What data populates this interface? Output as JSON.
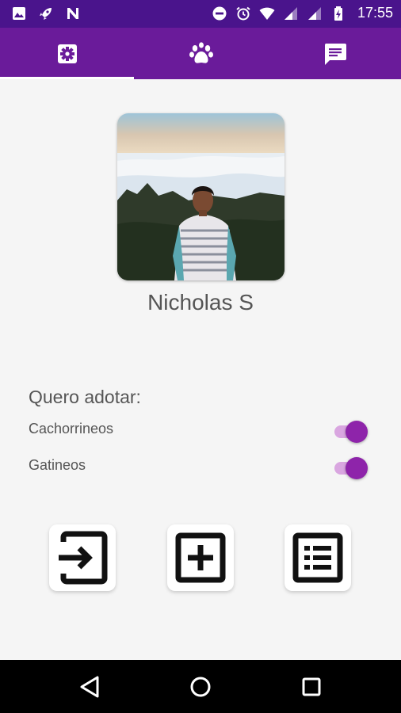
{
  "status_bar": {
    "time": "17:55",
    "left_icons": [
      "image-icon",
      "rocket-icon",
      "n-logo-icon"
    ],
    "right_icons": [
      "do-not-disturb-icon",
      "alarm-icon",
      "wifi-icon",
      "signal-icon",
      "signal-icon",
      "battery-charging-icon"
    ]
  },
  "tabs": [
    {
      "icon": "settings-icon",
      "selected": true
    },
    {
      "icon": "paw-icon",
      "selected": false
    },
    {
      "icon": "chat-icon",
      "selected": false
    }
  ],
  "profile": {
    "name": "Nicholas S"
  },
  "preferences": {
    "title": "Quero adotar:",
    "items": [
      {
        "label": "Cachorrineos",
        "enabled": true
      },
      {
        "label": "Gatineos",
        "enabled": true
      }
    ]
  },
  "actions": [
    {
      "icon": "logout-icon"
    },
    {
      "icon": "add-box-icon"
    },
    {
      "icon": "list-icon"
    }
  ],
  "nav_bar": {
    "icons": [
      "back-icon",
      "home-icon",
      "recents-icon"
    ]
  },
  "colors": {
    "status_bar": "#4a148c",
    "tab_bar": "#6a1b9a",
    "accent": "#8e24aa",
    "switch_track": "#d9a6e0",
    "background": "#f5f5f5"
  }
}
